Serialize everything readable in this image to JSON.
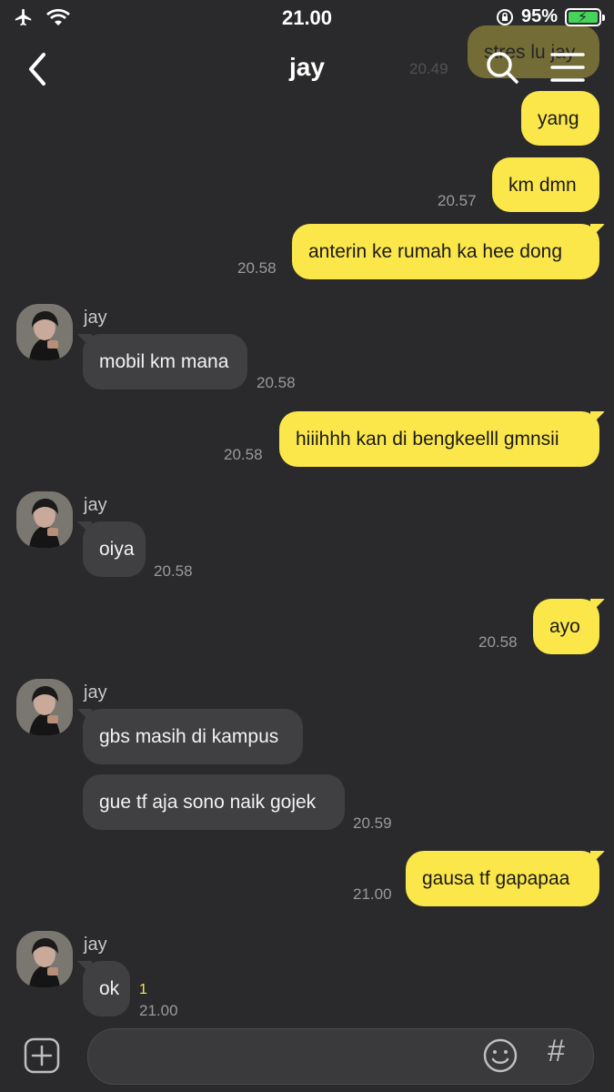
{
  "status_bar": {
    "time": "21.00",
    "battery": "95%"
  },
  "header": {
    "title": "jay"
  },
  "messages": {
    "m0": {
      "text": "stres lu jay",
      "time": "20.49"
    },
    "m1": {
      "text": "yang"
    },
    "m2": {
      "text": "km dmn",
      "time": "20.57"
    },
    "m3": {
      "text": "anterin ke rumah ka hee dong",
      "time": "20.58"
    },
    "m4": {
      "sender": "jay",
      "text": "mobil km mana",
      "time": "20.58"
    },
    "m5": {
      "text": "hiiihhh kan di bengkeelll gmnsii",
      "time": "20.58"
    },
    "m6": {
      "sender": "jay",
      "text": "oiya",
      "time": "20.58"
    },
    "m7": {
      "text": "ayo",
      "time": "20.58"
    },
    "m8": {
      "sender": "jay",
      "text": "gbs masih di kampus"
    },
    "m9": {
      "text": "gue tf aja sono naik gojek",
      "time": "20.59"
    },
    "m10": {
      "text": "gausa tf gapapaa",
      "time": "21.00"
    },
    "m11": {
      "sender": "jay",
      "text": "ok",
      "time": "21.00",
      "unread": "1"
    }
  },
  "input": {
    "hash_label": "#"
  },
  "colors": {
    "outgoing": "#fbe74a",
    "incoming": "#404043",
    "background": "#2a2a2c"
  }
}
